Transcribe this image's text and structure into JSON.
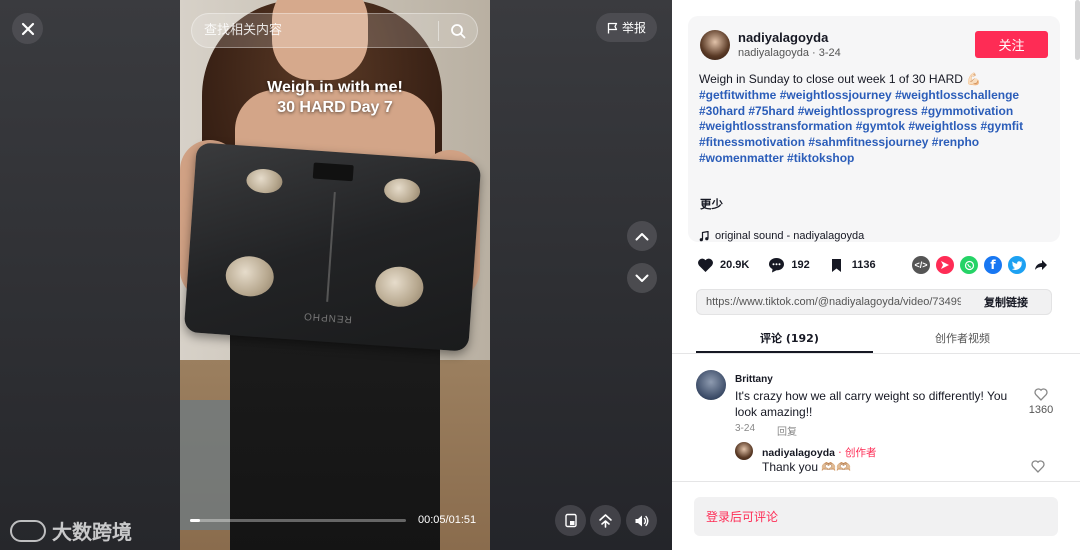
{
  "video": {
    "search_placeholder": "查找相关内容",
    "report_label": "举报",
    "caption_line1": "Weigh in with me!",
    "caption_line2": "30 HARD Day 7",
    "time": "00:05/01:51",
    "progress": 0.045,
    "scale_brand": "RENPHO",
    "watermark": "大数跨境"
  },
  "author": {
    "name": "nadiyalagoyda",
    "meta": "nadiyalagoyda · 3-24",
    "follow_label": "关注"
  },
  "post": {
    "text": "Weigh in Sunday to close out week 1 of 30 HARD 💪🏻",
    "hashtags": [
      "#getfitwithme",
      "#weightlossjourney",
      "#weightlosschallenge",
      "#30hard",
      "#75hard",
      "#weightlossprogress",
      "#gymmotivation",
      "#weightlosstransformation",
      "#gymtok",
      "#weightloss",
      "#gymfit",
      "#fitnessmotivation",
      "#sahmfitnessjourney",
      "#renpho",
      "#womenmatter",
      "#tiktokshop"
    ],
    "more_label": "更少",
    "sound": "original sound - nadiyalagoyda"
  },
  "stats": {
    "likes": "20.9K",
    "comments": "192",
    "saves": "1136"
  },
  "share": {
    "link": "https://www.tiktok.com/@nadiyalagoyda/video/734991...",
    "copy_label": "复制链接",
    "colors": {
      "embed": "#555555",
      "send": "#fe2c55",
      "whatsapp": "#25d366",
      "facebook": "#1877f2",
      "twitter": "#1da1f2"
    }
  },
  "tabs": {
    "comments": "评论 (192)",
    "creator_videos": "创作者视频"
  },
  "comments": [
    {
      "user": "Brittany",
      "text": "It's crazy how we all carry weight so differently! You look amazing!!",
      "date": "3-24",
      "reply_label": "回复",
      "likes": "1360"
    }
  ],
  "reply": {
    "user": "nadiyalagoyda",
    "creator_tag": " · 创作者",
    "text": "Thank you 🫶🏼🫶🏼"
  },
  "footer": {
    "login_prompt": "登录后可评论"
  }
}
